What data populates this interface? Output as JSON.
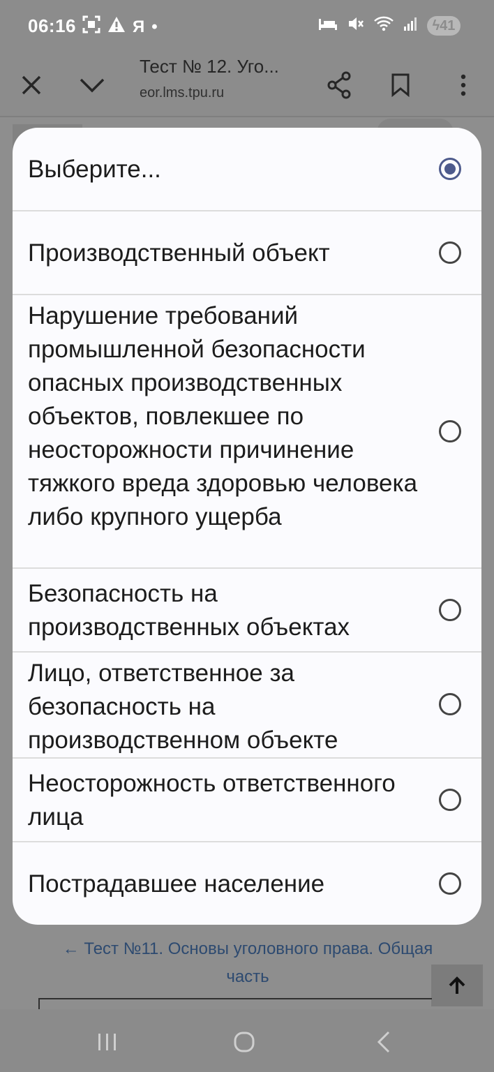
{
  "status_bar": {
    "time": "06:16",
    "left_icons": [
      "screenshot-icon",
      "warning-icon",
      "ya-icon",
      "dot-icon"
    ],
    "ya_label": "Я",
    "battery": "41"
  },
  "toolbar": {
    "title": "Тест № 12. Уго...",
    "url": "eor.lms.tpu.ru"
  },
  "select_dialog": {
    "options": [
      {
        "label": "Выберите...",
        "selected": true
      },
      {
        "label": "Производственный объект",
        "selected": false
      },
      {
        "label": "Нарушение требований промышленной безопасности опасных производственных объектов, повлекшее по неосторожности причинение тяжкого вреда здоровью человека либо крупного ущерба",
        "selected": false
      },
      {
        "label": "Безопасность на производственных объектах",
        "selected": false
      },
      {
        "label": "Лицо, ответственное за безопасность на производственном объекте",
        "selected": false
      },
      {
        "label": "Неосторожность ответственного лица",
        "selected": false
      },
      {
        "label": "Пострадавшее население",
        "selected": false
      }
    ]
  },
  "page": {
    "prev_link": "← Тест №11. Основы уголовного права. Общая часть"
  },
  "colors": {
    "radio_selected": "#4d5a8c",
    "link": "#2d4a70"
  }
}
